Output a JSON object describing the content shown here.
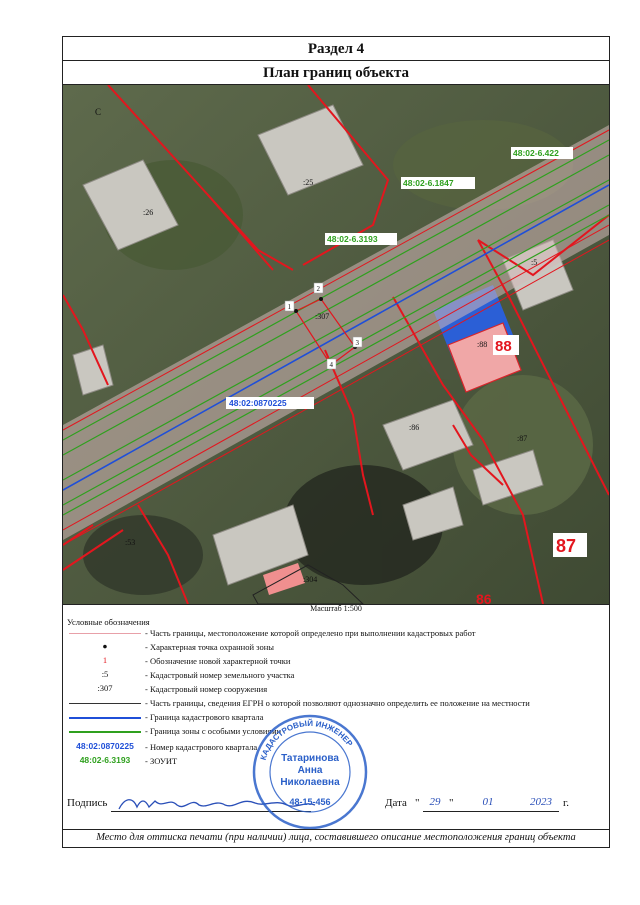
{
  "header": {
    "section": "Раздел 4",
    "title": "План границ объекта"
  },
  "map": {
    "parcel_labels": [
      ":26",
      ":25",
      ":5",
      ":307",
      ":88",
      ":86",
      ":87",
      ":53",
      ":304",
      "С"
    ],
    "quarter_label": "48:02:0870225",
    "zone_labels": [
      "48:02-6.422",
      "48:02-6.1847",
      "48:02-6.3193"
    ],
    "point_labels": [
      "1",
      "2",
      "3",
      "4"
    ],
    "house_numbers": [
      "88",
      "87",
      "86"
    ]
  },
  "scale": "Масштаб 1:500",
  "legend": {
    "title": "Условные обозначения",
    "items": [
      {
        "symbol": "",
        "text": "- Часть границы, местоположение которой определено при выполнении кадастровых работ"
      },
      {
        "symbol": "●",
        "text": "- Характерная точка охранной зоны"
      },
      {
        "symbol": "1",
        "text": "- Обозначение новой характерной точки"
      },
      {
        "symbol": ":5",
        "text": "- Кадастровый номер земельного участка"
      },
      {
        "symbol": ":307",
        "text": "- Кадастровый номер сооружения"
      },
      {
        "symbol": "",
        "text": "- Часть границы, сведения ЕГРН о которой позволяют однозначно определить ее положение на местности"
      },
      {
        "symbol": "",
        "text": "- Граница кадастрового квартала"
      },
      {
        "symbol": "",
        "text": "- Граница зоны с особыми условиями"
      },
      {
        "symbol": "48:02:0870225",
        "text": "- Номер кадастрового квартала"
      },
      {
        "symbol": "48:02-6.3193",
        "text": "- ЗОУИТ"
      }
    ]
  },
  "signature": {
    "label": "Подпись",
    "date_label": "Дата",
    "day": "29",
    "month": "01",
    "year": "2023",
    "year_suffix": "г."
  },
  "stamp": {
    "top": "КАДАСТРОВЫЙ ИНЖЕНЕР",
    "name1": "Татаринова",
    "name2": "Анна",
    "name3": "Николаевна",
    "number": "48-15-456"
  },
  "footer_note": "Место для оттиска печати (при наличии) лица, составившего описание местоположения границ объекта",
  "colors": {
    "boundary_red": "#e3161e",
    "quarter_blue": "#1f4fd8",
    "zone_green": "#2fa01e",
    "road_pink": "#e8a8b0",
    "stamp_blue": "#2a5fc8"
  }
}
